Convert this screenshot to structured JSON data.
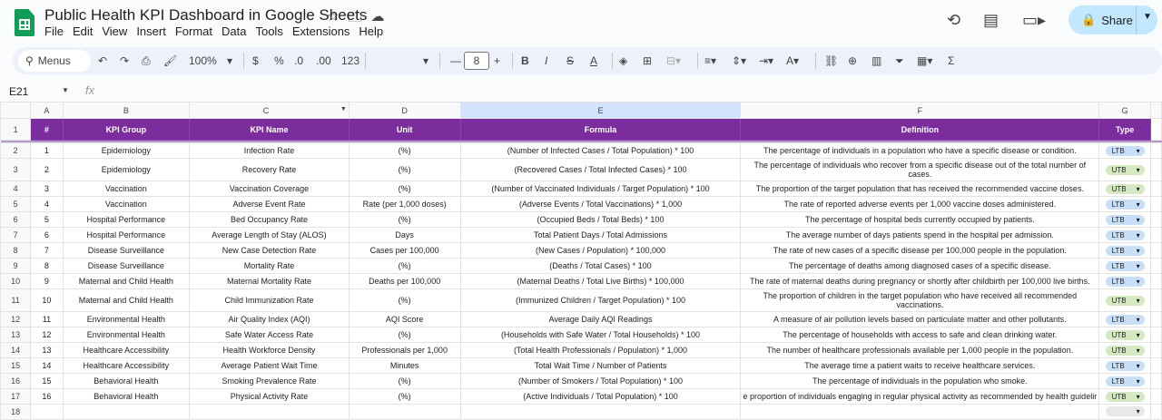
{
  "doc": {
    "title": "Public Health KPI Dashboard in Google Sheets"
  },
  "menu": [
    "File",
    "Edit",
    "View",
    "Insert",
    "Format",
    "Data",
    "Tools",
    "Extensions",
    "Help"
  ],
  "share": {
    "label": "Share"
  },
  "toolbar": {
    "menus_label": "Menus",
    "zoom": "100%",
    "currency": "$",
    "percent": "%",
    "dec_dec": ".0",
    "inc_dec": ".00",
    "format": "123",
    "font_size": "8"
  },
  "namebox": {
    "value": "E21"
  },
  "fx_label": "fx",
  "columns": [
    "A",
    "B",
    "C",
    "D",
    "E",
    "F",
    "G"
  ],
  "headers": [
    "#",
    "KPI Group",
    "KPI Name",
    "Unit",
    "Formula",
    "Definition",
    "Type"
  ],
  "rows": [
    [
      "1",
      "Epidemiology",
      "Infection Rate",
      "(%)",
      "(Number of Infected Cases / Total Population) * 100",
      "The percentage of individuals in a population who have a specific disease or condition.",
      "LTB"
    ],
    [
      "2",
      "Epidemiology",
      "Recovery Rate",
      "(%)",
      "(Recovered Cases / Total Infected Cases) * 100",
      "The percentage of individuals who recover from a specific disease out of the total number of cases.",
      "UTB"
    ],
    [
      "3",
      "Vaccination",
      "Vaccination Coverage",
      "(%)",
      "(Number of Vaccinated Individuals / Target Population) * 100",
      "The proportion of the target population that has received the recommended vaccine doses.",
      "UTB"
    ],
    [
      "4",
      "Vaccination",
      "Adverse Event Rate",
      "Rate (per 1,000 doses)",
      "(Adverse Events / Total Vaccinations) * 1,000",
      "The rate of reported adverse events per 1,000 vaccine doses administered.",
      "LTB"
    ],
    [
      "5",
      "Hospital Performance",
      "Bed Occupancy Rate",
      "(%)",
      "(Occupied Beds / Total Beds) * 100",
      "The percentage of hospital beds currently occupied by patients.",
      "LTB"
    ],
    [
      "6",
      "Hospital Performance",
      "Average Length of Stay (ALOS)",
      "Days",
      "Total Patient Days / Total Admissions",
      "The average number of days patients spend in the hospital per admission.",
      "LTB"
    ],
    [
      "7",
      "Disease Surveillance",
      "New Case Detection Rate",
      "Cases per 100,000",
      "(New Cases / Population) * 100,000",
      "The rate of new cases of a specific disease per 100,000 people in the population.",
      "LTB"
    ],
    [
      "8",
      "Disease Surveillance",
      "Mortality Rate",
      "(%)",
      "(Deaths / Total Cases) * 100",
      "The percentage of deaths among diagnosed cases of a specific disease.",
      "LTB"
    ],
    [
      "9",
      "Maternal and Child Health",
      "Maternal Mortality Rate",
      "Deaths per 100,000",
      "(Maternal Deaths / Total Live Births) * 100,000",
      "The rate of maternal deaths during pregnancy or shortly after childbirth per 100,000 live births.",
      "LTB"
    ],
    [
      "10",
      "Maternal and Child Health",
      "Child Immunization Rate",
      "(%)",
      "(Immunized Children / Target Population) * 100",
      "The proportion of children in the target population who have received all recommended vaccinations.",
      "UTB"
    ],
    [
      "11",
      "Environmental Health",
      "Air Quality Index (AQI)",
      "AQI Score",
      "Average Daily AQI Readings",
      "A measure of air pollution levels based on particulate matter and other pollutants.",
      "LTB"
    ],
    [
      "12",
      "Environmental Health",
      "Safe Water Access Rate",
      "(%)",
      "(Households with Safe Water / Total Households) * 100",
      "The percentage of households with access to safe and clean drinking water.",
      "UTB"
    ],
    [
      "13",
      "Healthcare Accessibility",
      "Health Workforce Density",
      "Professionals per 1,000",
      "(Total Health Professionals / Population) * 1,000",
      "The number of healthcare professionals available per 1,000 people in the population.",
      "UTB"
    ],
    [
      "14",
      "Healthcare Accessibility",
      "Average Patient Wait Time",
      "Minutes",
      "Total Wait Time / Number of Patients",
      "The average time a patient waits to receive healthcare services.",
      "LTB"
    ],
    [
      "15",
      "Behavioral Health",
      "Smoking Prevalence Rate",
      "(%)",
      "(Number of Smokers / Total Population) * 100",
      "The percentage of individuals in the population who smoke.",
      "LTB"
    ],
    [
      "16",
      "Behavioral Health",
      "Physical Activity Rate",
      "(%)",
      "(Active Individuals / Total Population) * 100",
      "e proportion of individuals engaging in regular physical activity as recommended by health guidelir",
      "UTB"
    ]
  ],
  "row_numbers": [
    "1",
    "2",
    "3",
    "4",
    "5",
    "6",
    "7",
    "8",
    "9",
    "10",
    "11",
    "12",
    "13",
    "14",
    "15",
    "16",
    "17",
    "18"
  ],
  "colors": {
    "header_bg": "#7b2d9e",
    "ltb_chip": "#c9def7",
    "utb_chip": "#d4e8c2",
    "share_bg": "#c2e7ff"
  }
}
